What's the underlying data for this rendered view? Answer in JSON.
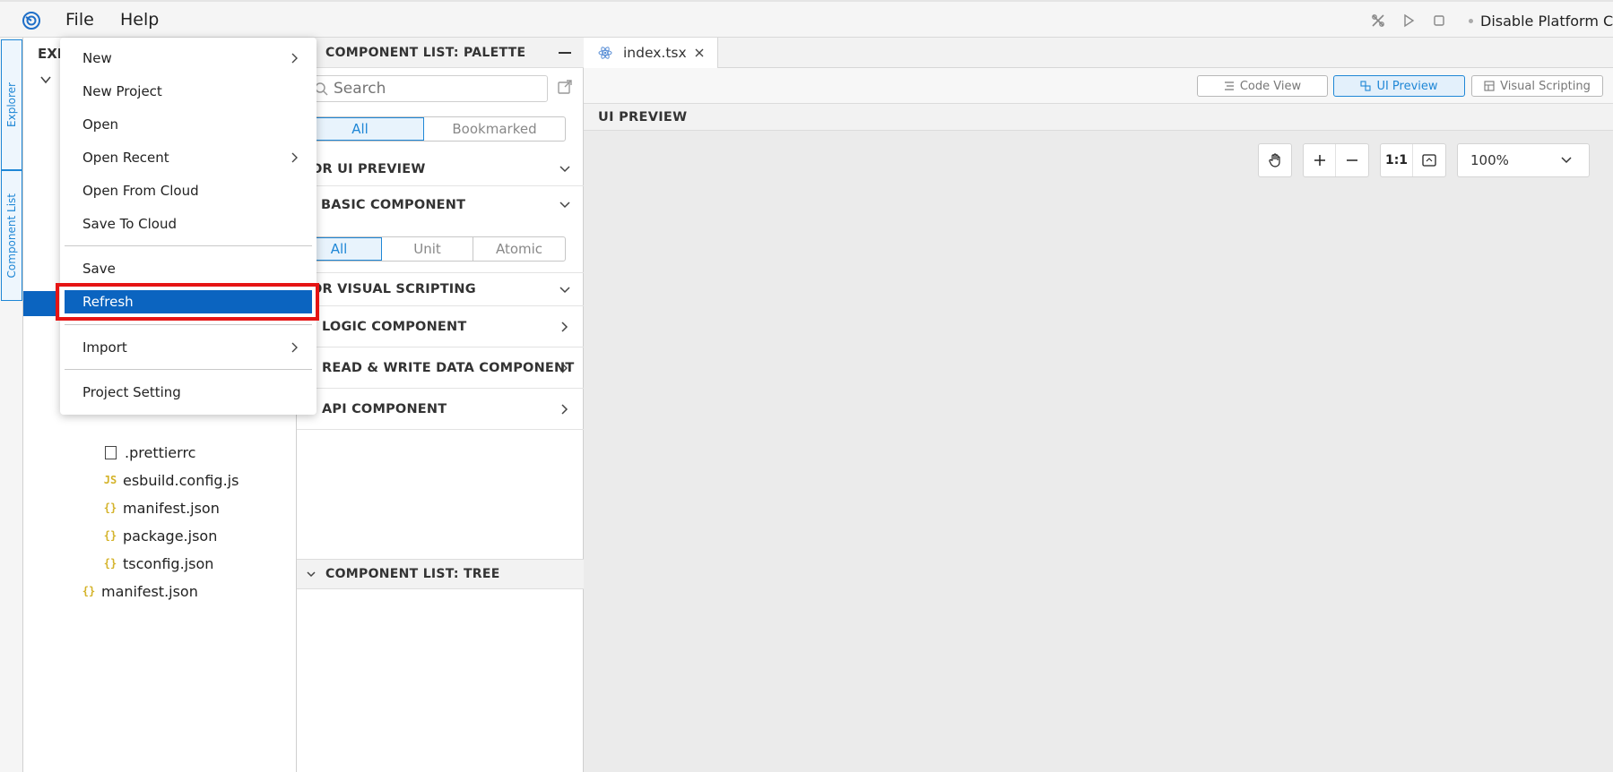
{
  "menubar": {
    "logo_icon": "app-logo-icon",
    "file": "File",
    "help": "Help",
    "platform_toggle": "Disable Platform Co"
  },
  "activitybar": {
    "explorer": "Explorer",
    "component_list": "Component List"
  },
  "explorer": {
    "title": "EXP",
    "files": [
      {
        "name": ".prettierrc",
        "icon": "blank-file-icon"
      },
      {
        "name": "esbuild.config.js",
        "icon": "js-file-icon",
        "badge": "JS"
      },
      {
        "name": "manifest.json",
        "icon": "json-file-icon",
        "badge": "{}"
      },
      {
        "name": "package.json",
        "icon": "json-file-icon",
        "badge": "{}"
      },
      {
        "name": "tsconfig.json",
        "icon": "json-file-icon",
        "badge": "{}"
      },
      {
        "name": "manifest.json",
        "icon": "json-file-icon",
        "badge": "{}"
      }
    ]
  },
  "file_menu": {
    "items": [
      {
        "label": "New",
        "submenu": true
      },
      {
        "label": "New Project"
      },
      {
        "label": "Open"
      },
      {
        "label": "Open Recent",
        "submenu": true
      },
      {
        "label": "Open From Cloud"
      },
      {
        "label": "Save To Cloud"
      },
      {
        "label": "Save"
      },
      {
        "label": "Refresh",
        "selected": true
      },
      {
        "label": "Import",
        "submenu": true
      },
      {
        "label": "Project Setting"
      }
    ]
  },
  "palette": {
    "title": "COMPONENT LIST: PALETTE",
    "search_placeholder": "Search",
    "filter_tabs": [
      "All",
      "Bookmarked"
    ],
    "ui_preview_section": "OR UI PREVIEW",
    "basic_component": "BASIC COMPONENT",
    "basic_tabs": [
      "All",
      "Unit",
      "Atomic"
    ],
    "visual_scripting_section": "OR VISUAL SCRIPTING",
    "logic_component": "LOGIC COMPONENT",
    "read_write_component": "READ & WRITE DATA COMPONENT",
    "api_component": "API COMPONENT",
    "tree_title": "COMPONENT LIST: TREE"
  },
  "editor": {
    "tab_name": "index.tsx",
    "views": [
      {
        "label": "Code View",
        "active": false
      },
      {
        "label": "UI Preview",
        "active": true
      },
      {
        "label": "Visual Scripting",
        "active": false
      }
    ],
    "preview_label": "UI PREVIEW",
    "ratio_label": "1:1",
    "zoom": "100%"
  },
  "colors": {
    "accent": "#1f87d6",
    "selection": "#0b64c0",
    "highlight_border": "#e51414"
  }
}
